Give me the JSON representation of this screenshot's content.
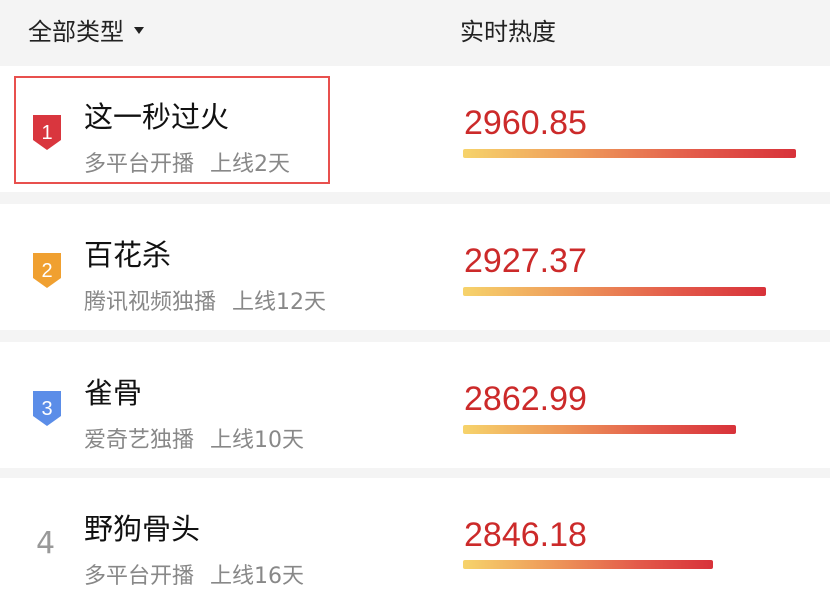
{
  "header": {
    "filter_label": "全部类型",
    "heat_column_label": "实时热度"
  },
  "colors": {
    "value_red": "#cc2a2a",
    "rank1": "#d9363e",
    "rank2": "#f0a030",
    "rank3": "#5b8de8",
    "highlight": "#e8504e"
  },
  "items": [
    {
      "rank": "1",
      "title": "这一秒过火",
      "platform": "多平台开播",
      "online": "上线2天",
      "heat": "2960.85",
      "heat_fraction": 1.0
    },
    {
      "rank": "2",
      "title": "百花杀",
      "platform": "腾讯视频独播",
      "online": "上线12天",
      "heat": "2927.37",
      "heat_fraction": 0.91
    },
    {
      "rank": "3",
      "title": "雀骨",
      "platform": "爱奇艺独播",
      "online": "上线10天",
      "heat": "2862.99",
      "heat_fraction": 0.82
    },
    {
      "rank": "4",
      "title": "野狗骨头",
      "platform": "多平台开播",
      "online": "上线16天",
      "heat": "2846.18",
      "heat_fraction": 0.75
    }
  ]
}
